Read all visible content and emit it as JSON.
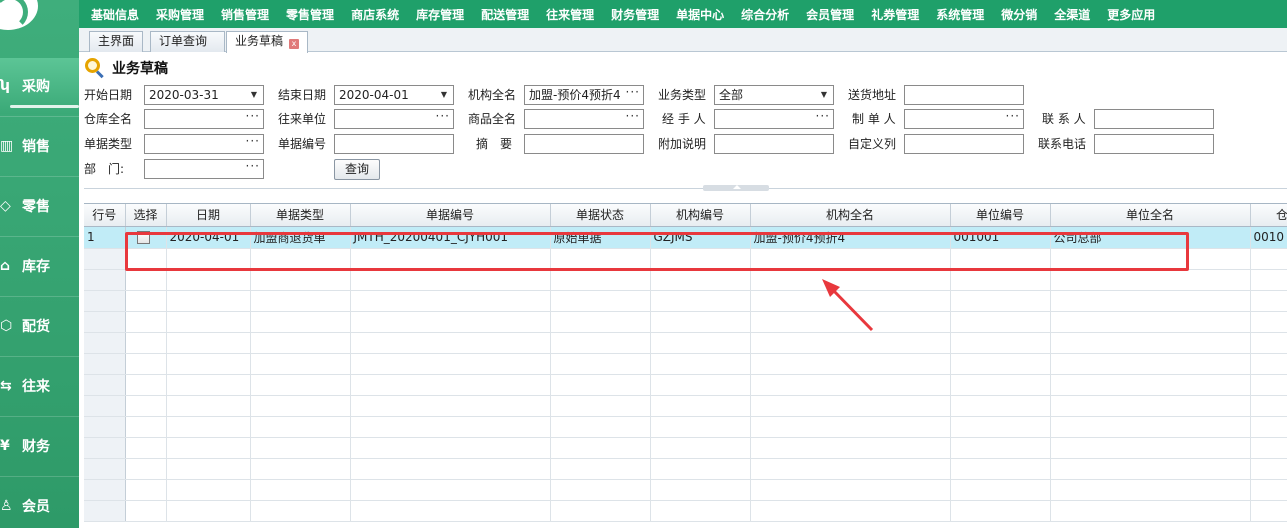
{
  "sidebar": {
    "items": [
      {
        "icon": "cart-icon",
        "glyph": "ʮ",
        "label": "采购"
      },
      {
        "icon": "chart-icon",
        "glyph": "▥",
        "label": "销售"
      },
      {
        "icon": "tag-icon",
        "glyph": "◇",
        "label": "零售"
      },
      {
        "icon": "house-icon",
        "glyph": "⌂",
        "label": "库存"
      },
      {
        "icon": "box-icon",
        "glyph": "⬡",
        "label": "配货"
      },
      {
        "icon": "swap-icon",
        "glyph": "⇆",
        "label": "往来"
      },
      {
        "icon": "yen-icon",
        "glyph": "¥",
        "label": "财务"
      },
      {
        "icon": "user-icon",
        "glyph": "♙",
        "label": "会员"
      }
    ]
  },
  "topmenu": {
    "items": [
      "基础信息",
      "采购管理",
      "销售管理",
      "零售管理",
      "商店系统",
      "库存管理",
      "配送管理",
      "往来管理",
      "财务管理",
      "单据中心",
      "综合分析",
      "会员管理",
      "礼券管理",
      "系统管理",
      "微分销",
      "全渠道",
      "更多应用"
    ]
  },
  "tabs": {
    "main": "主界面",
    "order_query": "订单查询",
    "drafts": "业务草稿",
    "close_glyph": "x"
  },
  "page": {
    "title": "业务草稿"
  },
  "form": {
    "start_date_label": "开始日期",
    "start_date": "2020-03-31",
    "end_date_label": "结束日期",
    "end_date": "2020-04-01",
    "org_name_label": "机构全名",
    "org_name": "加盟-预价4预折4",
    "biz_type_label": "业务类型",
    "biz_type": "全部",
    "ship_addr_label": "送货地址",
    "warehouse_label": "仓库全名",
    "partner_label": "往来单位",
    "product_label": "商品全名",
    "handler_label": "经 手 人",
    "maker_label": "制 单 人",
    "contact_label": "联 系 人",
    "doc_type_label": "单据类型",
    "doc_no_label": "单据编号",
    "summary_label": "摘　要",
    "extra_label": "附加说明",
    "custom_label": "自定义列",
    "phone_label": "联系电话",
    "dept_label": "部　门:",
    "query_button": "查询"
  },
  "grid": {
    "columns": [
      "行号",
      "选择",
      "日期",
      "单据类型",
      "单据编号",
      "单据状态",
      "机构编号",
      "机构全名",
      "单位编号",
      "单位全名",
      "仓"
    ],
    "rows": [
      {
        "row_no": "1",
        "date": "2020-04-01",
        "doc_type": "加盟商退货单",
        "doc_no": "JMTH_20200401_CJYH001",
        "status": "原始单据",
        "org_code": "GZJMS",
        "org_name": "加盟-预价4预折4",
        "unit_code": "001001",
        "unit_name": "公司总部",
        "extra": "0010"
      }
    ]
  },
  "colors": {
    "sidebar": "#3fae7c",
    "topmenu": "#1fa06a",
    "selected_row": "#c1ecf7",
    "highlight": "#e8383d"
  }
}
